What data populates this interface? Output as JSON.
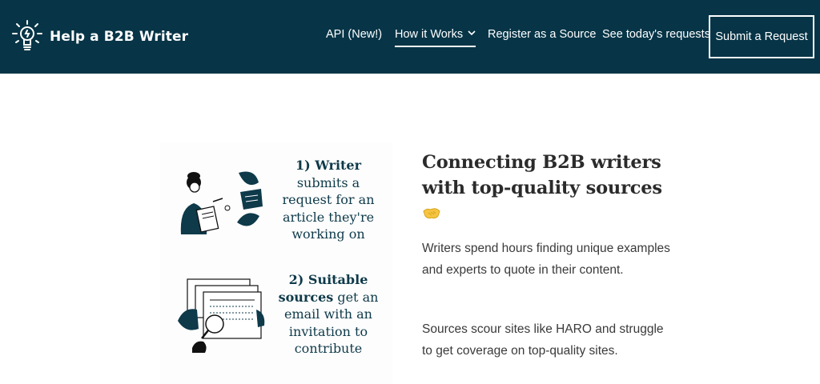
{
  "brand": {
    "name": "Help a B2B Writer"
  },
  "nav": {
    "items": [
      {
        "label": "API (New!)"
      },
      {
        "label": "How it Works"
      },
      {
        "label": "Register as a Source"
      },
      {
        "label": "See today's requests"
      }
    ],
    "cta": "Submit a Request"
  },
  "steps": [
    {
      "title": "1) Writer",
      "body": "submits a request for an article they're working on"
    },
    {
      "title": "2) Suitable sources",
      "body": "get an email with an invitation to contribute"
    }
  ],
  "hero": {
    "title": "Connecting B2B writers with top-quality sources",
    "emoji_icon": "handshake-icon",
    "paragraphs": [
      "Writers spend hours finding unique examples and experts to quote in their content.",
      "Sources scour sites like HARO and struggle to get coverage on top-quality sites."
    ]
  },
  "colors": {
    "header_bg": "#073547",
    "text_dark": "#2b2b2b",
    "accent": "#0e3a4a"
  }
}
